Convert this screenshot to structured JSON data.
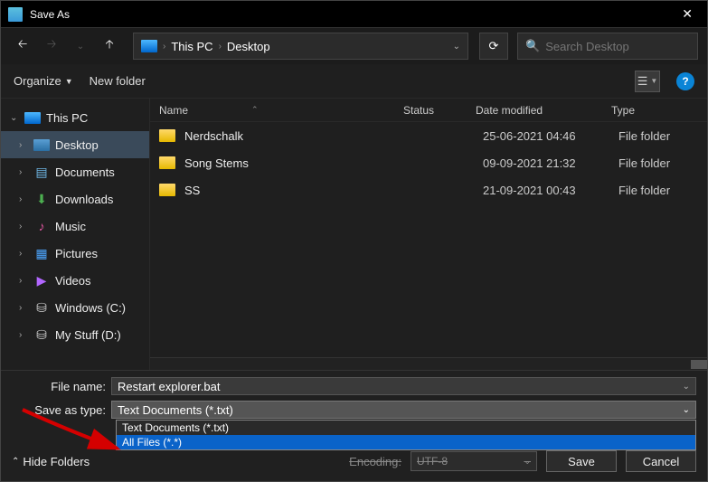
{
  "window": {
    "title": "Save As"
  },
  "nav": {
    "breadcrumbs": [
      "This PC",
      "Desktop"
    ],
    "search_placeholder": "Search Desktop"
  },
  "toolbar": {
    "organize": "Organize",
    "new_folder": "New folder"
  },
  "sidebar": {
    "items": [
      {
        "label": "This PC",
        "icon": "pc",
        "expanded": true,
        "selected": false
      },
      {
        "label": "Desktop",
        "icon": "desk",
        "expanded": false,
        "selected": true
      },
      {
        "label": "Documents",
        "icon": "doc",
        "expanded": false,
        "selected": false
      },
      {
        "label": "Downloads",
        "icon": "dl",
        "expanded": false,
        "selected": false
      },
      {
        "label": "Music",
        "icon": "music",
        "expanded": false,
        "selected": false
      },
      {
        "label": "Pictures",
        "icon": "pic",
        "expanded": false,
        "selected": false
      },
      {
        "label": "Videos",
        "icon": "vid",
        "expanded": false,
        "selected": false
      },
      {
        "label": "Windows (C:)",
        "icon": "drive",
        "expanded": false,
        "selected": false
      },
      {
        "label": "My Stuff (D:)",
        "icon": "drive",
        "expanded": false,
        "selected": false
      }
    ]
  },
  "columns": {
    "name": "Name",
    "status": "Status",
    "date": "Date modified",
    "type": "Type"
  },
  "rows": [
    {
      "name": "Nerdschalk",
      "date": "25-06-2021 04:46",
      "type": "File folder"
    },
    {
      "name": "Song Stems",
      "date": "09-09-2021 21:32",
      "type": "File folder"
    },
    {
      "name": "SS",
      "date": "21-09-2021 00:43",
      "type": "File folder"
    }
  ],
  "footer": {
    "filename_label": "File name:",
    "filename_value": "Restart explorer.bat",
    "savetype_label": "Save as type:",
    "savetype_value": "Text Documents (*.txt)",
    "type_options": [
      "Text Documents (*.txt)",
      "All Files  (*.*)"
    ],
    "encoding_label": "Encoding:",
    "encoding_value": "UTF-8",
    "hide_folders": "Hide Folders",
    "save": "Save",
    "cancel": "Cancel"
  }
}
